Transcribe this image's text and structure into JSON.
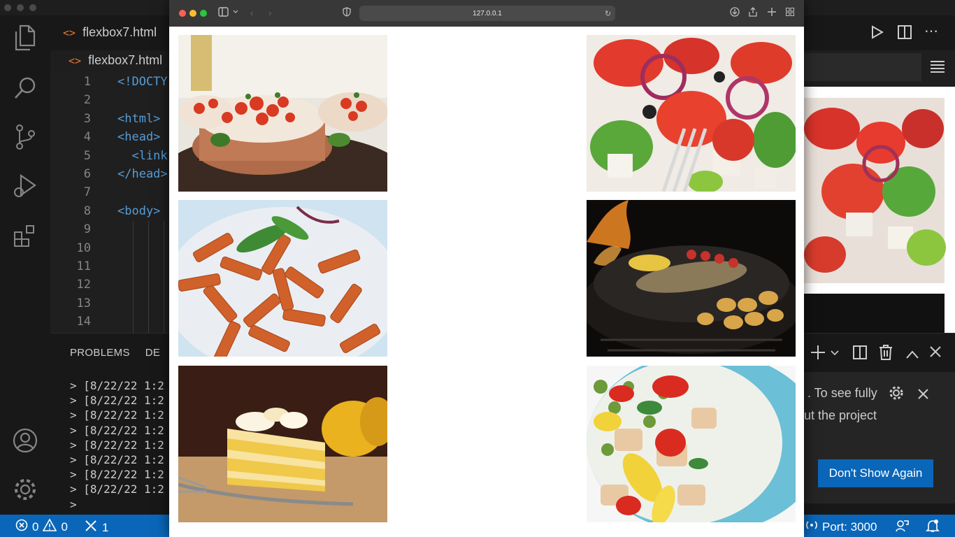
{
  "editor": {
    "tab_top": "flexbox7.html",
    "tab_second": "flexbox7.html",
    "line_numbers": [
      "1",
      "2",
      "3",
      "4",
      "5",
      "6",
      "7",
      "8",
      "9",
      "10",
      "11",
      "12",
      "13",
      "14"
    ],
    "code_lines": [
      "<!DOCTY",
      "",
      "<html>",
      "<head>",
      "  <link",
      "</head>",
      "",
      "<body>"
    ]
  },
  "panel": {
    "tabs": [
      "PROBLEMS",
      "DE"
    ],
    "terminal_lines": [
      "> [8/22/22 1:2",
      "> [8/22/22 1:2",
      "> [8/22/22 1:2",
      "> [8/22/22 1:2",
      "> [8/22/22 1:2",
      "> [8/22/22 1:2",
      "> [8/22/22 1:2",
      "> [8/22/22 1:2",
      ">"
    ]
  },
  "notification": {
    "line1": ". To see fully",
    "line2": "ut the project",
    "button": "Don't Show Again"
  },
  "statusbar": {
    "errors": "0",
    "warnings": "0",
    "ports_count": "1",
    "port": "Port: 3000"
  },
  "browser": {
    "url": "127.0.0.1",
    "images": [
      {
        "name": "bruschetta-image"
      },
      {
        "name": "greek-salad-image"
      },
      {
        "name": "penne-pasta-image"
      },
      {
        "name": "grilled-fish-image"
      },
      {
        "name": "lemon-cake-image"
      },
      {
        "name": "chicken-salad-image"
      }
    ]
  },
  "colors": {
    "statusbar": "#0a66b8",
    "editor_bg": "#1e1e1e",
    "html_tag": "#569cd6",
    "file_icon": "#e37933"
  }
}
